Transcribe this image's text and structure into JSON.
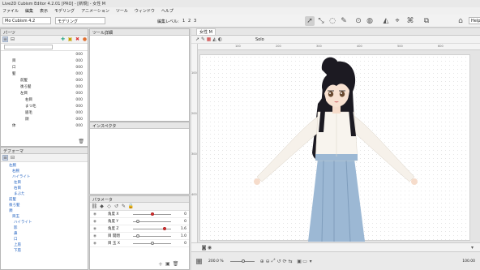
{
  "window": {
    "title": "Live2D Cubism Editor 4.2.01 [PRO] - [新規] - 女性 M"
  },
  "menu": [
    "ファイル",
    "編集",
    "表示",
    "モデリング",
    "アニメーション",
    "ツール",
    "ウィンドウ",
    "ヘルプ"
  ],
  "toolbar": {
    "model_select": "Mo Cubism 4.2",
    "mode_select": "モデリング",
    "edit_level_label": "編集レベル:",
    "levels": [
      "1",
      "2",
      "3"
    ],
    "help_button": "Help"
  },
  "parts_panel": {
    "title": "パーツ",
    "rows": [
      {
        "label": "",
        "value": "000"
      },
      {
        "label": "目",
        "value": "000"
      },
      {
        "label": "口",
        "value": "000"
      },
      {
        "label": "髪",
        "value": "000"
      },
      {
        "label": "前髪",
        "value": "000"
      },
      {
        "label": "後ろ髪",
        "value": "000"
      },
      {
        "label": "左目",
        "value": "000"
      },
      {
        "label": "右目",
        "value": "000"
      },
      {
        "label": "まつ毛",
        "value": "000"
      },
      {
        "label": "眉毛",
        "value": "000"
      },
      {
        "label": "顔",
        "value": "000"
      },
      {
        "label": "体",
        "value": "000"
      }
    ]
  },
  "deformer_panel": {
    "title": "デフォーマ",
    "rows": [
      "左腕",
      "右腕",
      "ハイライト",
      "左目",
      "右目",
      "まぶた",
      "前髪",
      "後ろ髪",
      "頬",
      "目玉",
      "ハイライト",
      "影",
      "鼻",
      "口",
      "上唇",
      "下唇"
    ]
  },
  "tool_detail_panel": {
    "title": "ツール詳細"
  },
  "inspector_panel": {
    "title": "インスペクタ"
  },
  "params_panel": {
    "title": "パラメータ",
    "rows": [
      {
        "label": "角度 X",
        "value": "0",
        "knob": 0.5,
        "red": true
      },
      {
        "label": "角度 Y",
        "value": "0",
        "knob": 0.1,
        "red": false
      },
      {
        "label": "角度 Z",
        "value": "1.6",
        "knob": 0.85,
        "red": true
      },
      {
        "label": "目 開閉",
        "value": "1.0",
        "knob": 0.1,
        "red": false
      },
      {
        "label": "目 玉 X",
        "value": "0",
        "knob": 0.5,
        "red": false
      }
    ]
  },
  "view": {
    "tab": "女性 M",
    "solo_label": "Solo",
    "zoom_value": "200.0 %",
    "status_left": "",
    "coords": "100.00"
  },
  "ruler_ticks": [
    "100",
    "200",
    "300",
    "400",
    "500",
    "600",
    "700"
  ]
}
